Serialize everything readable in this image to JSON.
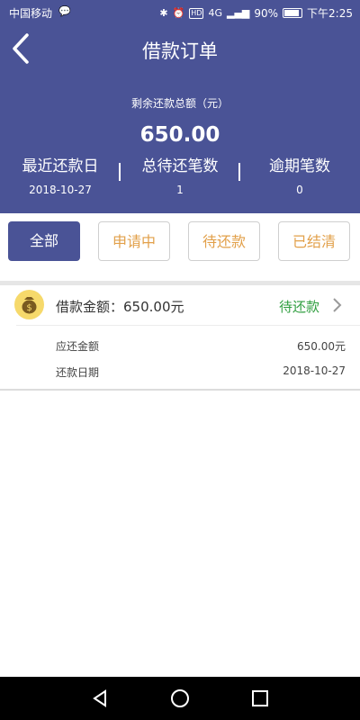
{
  "statusbar": {
    "carrier": "中国移动",
    "hd": "HD",
    "network": "4G",
    "battery": "90%",
    "time": "下午2:25"
  },
  "header": {
    "title": "借款订单",
    "remaining_label": "剩余还款总额（元）",
    "remaining_amount": "650.00",
    "stats": [
      {
        "label": "最近还款日",
        "value": "2018-10-27"
      },
      {
        "label": "总待还笔数",
        "value": "1"
      },
      {
        "label": "逾期笔数",
        "value": "0"
      }
    ]
  },
  "tabs": [
    {
      "label": "全部",
      "active": true
    },
    {
      "label": "申请中",
      "active": false
    },
    {
      "label": "待还款",
      "active": false
    },
    {
      "label": "已结清",
      "active": false
    }
  ],
  "order": {
    "title": "借款金额：650.00元",
    "status": "待还款",
    "details": [
      {
        "label": "应还金额",
        "value": "650.00元"
      },
      {
        "label": "还款日期",
        "value": "2018-10-27"
      }
    ]
  },
  "colors": {
    "primary": "#4a5396",
    "tab_text": "#e2a04a",
    "status_green": "#2f9e3f",
    "coin": "#f6d96b"
  },
  "icons": {
    "back": "back-arrow-icon",
    "chevron": "chevron-right-icon",
    "coin": "money-bag-icon",
    "nav_back": "triangle-back-icon",
    "nav_home": "circle-home-icon",
    "nav_recent": "square-recent-icon"
  }
}
